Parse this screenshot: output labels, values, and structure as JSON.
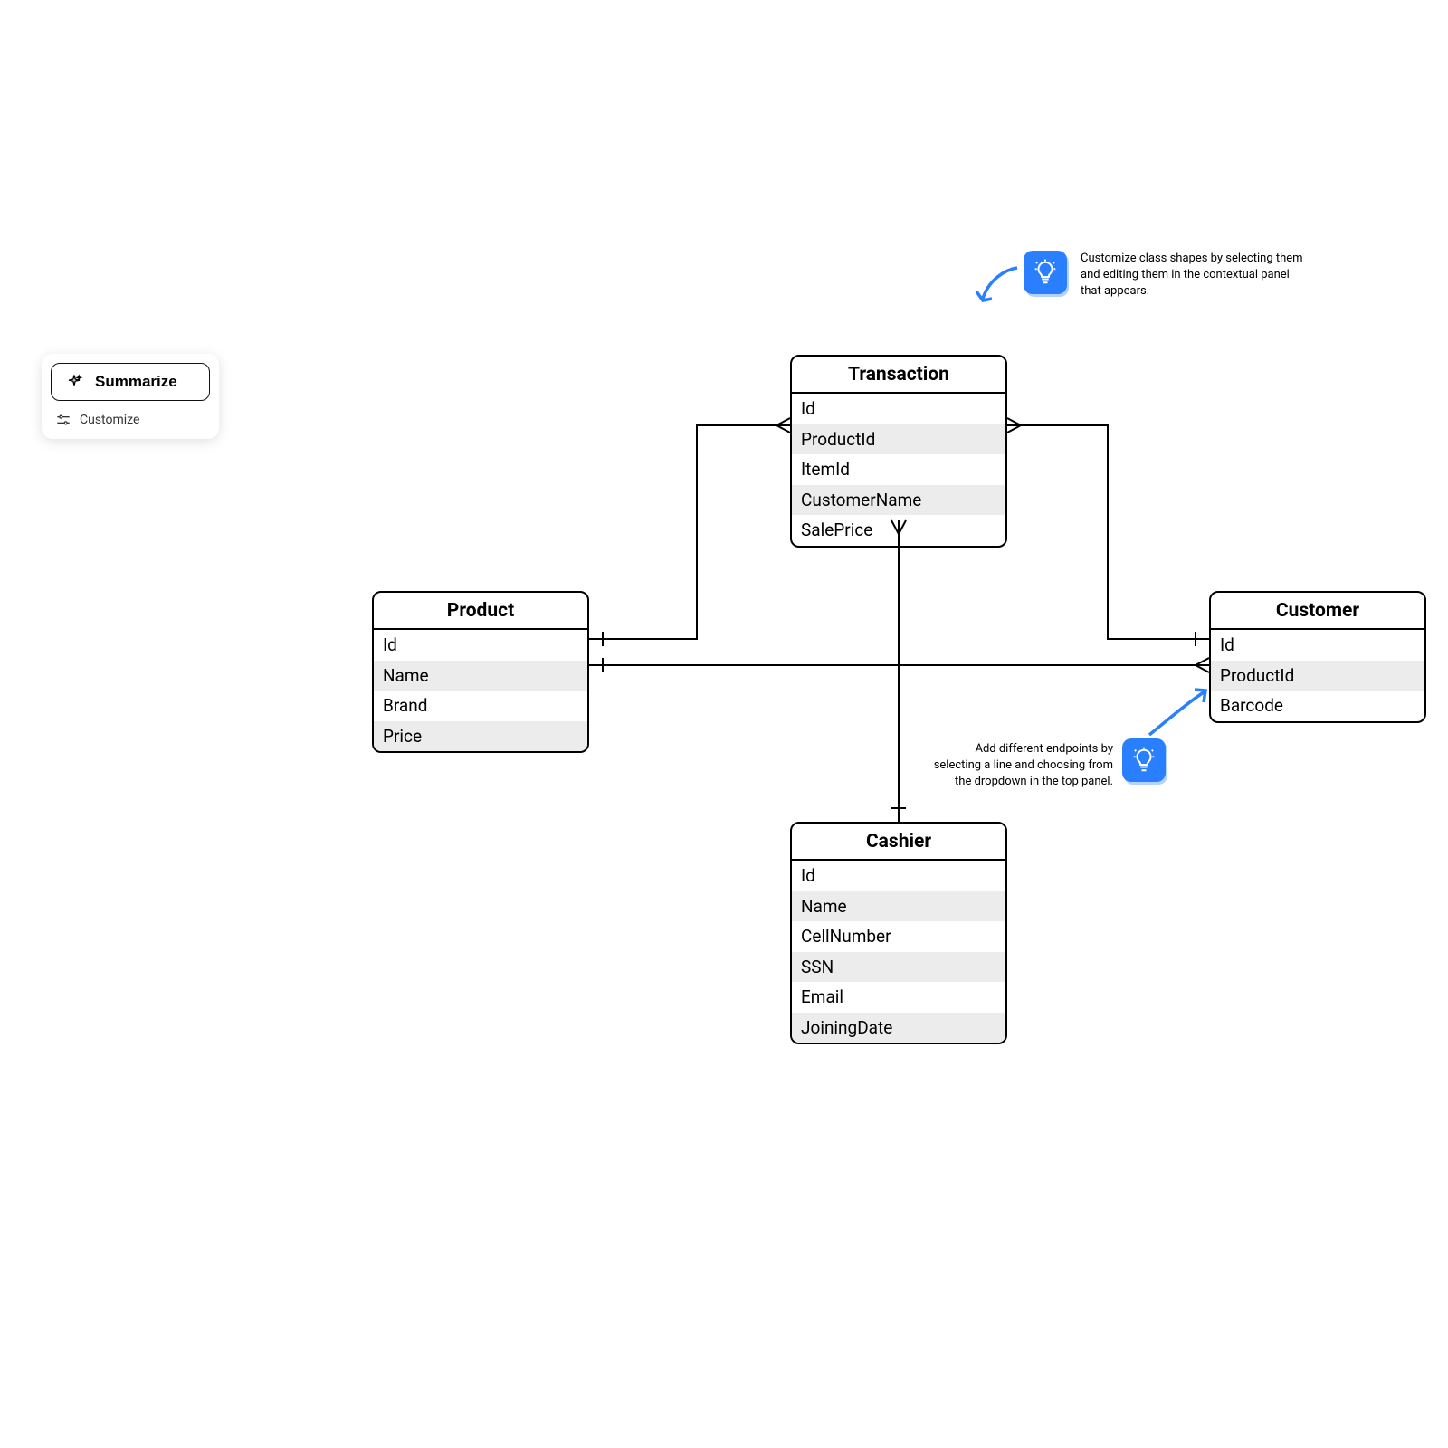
{
  "toolbar": {
    "summarize_label": "Summarize",
    "customize_label": "Customize"
  },
  "entities": {
    "transaction": {
      "title": "Transaction",
      "attrs": [
        "Id",
        "ProductId",
        "ItemId",
        "CustomerName",
        "SalePrice"
      ]
    },
    "product": {
      "title": "Product",
      "attrs": [
        "Id",
        "Name",
        "Brand",
        "Price"
      ]
    },
    "customer": {
      "title": "Customer",
      "attrs": [
        "Id",
        "ProductId",
        "Barcode"
      ]
    },
    "cashier": {
      "title": "Cashier",
      "attrs": [
        "Id",
        "Name",
        "CellNumber",
        "SSN",
        "Email",
        "JoiningDate"
      ]
    }
  },
  "tips": {
    "top": "Customize class shapes by selecting them and editing them in the contextual panel that appears.",
    "bottom": "Add different endpoints by selecting a line and choosing from the dropdown in the top panel."
  }
}
